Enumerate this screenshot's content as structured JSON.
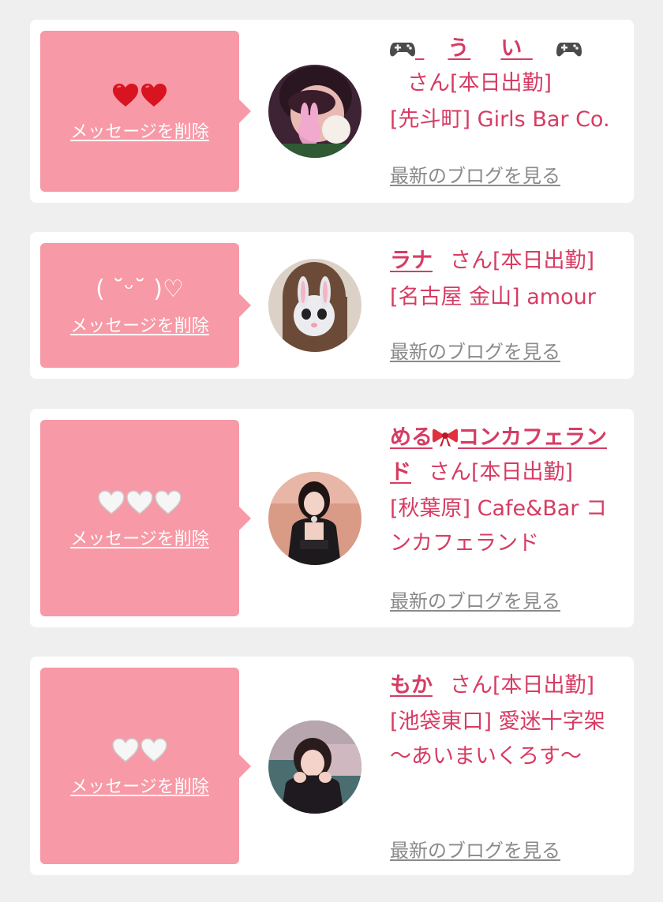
{
  "delete_label": "メッセージを削除",
  "blog_label": "最新のブログを見る",
  "colors": {
    "background": "#efefef",
    "card": "#ffffff",
    "bubble": "#f799a6",
    "name": "#d63c63",
    "blog_link": "#8a8a8a"
  },
  "cards": [
    {
      "message": "",
      "message_icons": [
        "red-heart-icon",
        "red-heart-icon"
      ],
      "name_parts": [
        "🎮",
        "う",
        "い",
        "🎮"
      ],
      "name_icons": [
        "game-controller-icon",
        "game-controller-icon"
      ],
      "name_suffix": "さん[本日出勤]",
      "shop": "[先斗町] Girls Bar Co."
    },
    {
      "message": "( ˘ᵕ˘ )♡",
      "message_icons": [],
      "name": "ラナ",
      "name_suffix": "さん[本日出勤]",
      "shop": "[名古屋 金山] amour"
    },
    {
      "message": "",
      "message_icons": [
        "white-heart-icon",
        "white-heart-icon",
        "white-heart-icon"
      ],
      "name_before": "める",
      "name_icon": "ribbon-icon",
      "name_after": "コンカフェランド",
      "name_suffix": "さん[本日出勤]",
      "shop": "[秋葉原] Cafe&Bar コンカフェランド"
    },
    {
      "message": "",
      "message_icons": [
        "white-heart-icon",
        "white-heart-icon"
      ],
      "name": "もか",
      "name_suffix": "さん[本日出勤]",
      "shop": "[池袋東口] 愛迷十字架 〜あいまいくろす〜"
    }
  ]
}
